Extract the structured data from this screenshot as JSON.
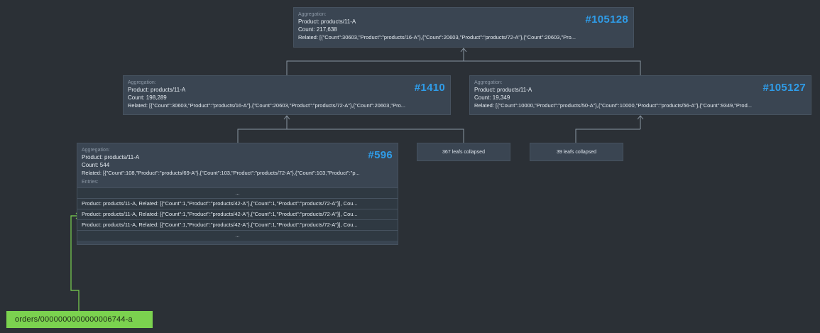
{
  "nodes": {
    "n105128": {
      "id": "#105128",
      "header": "Aggregation:",
      "product": "Product: products/11-A",
      "count": "Count: 217,638",
      "related": "Related: [{\"Count\":30603,\"Product\":\"products/16-A\"},{\"Count\":20603,\"Product\":\"products/72-A\"},{\"Count\":20603,\"Pro..."
    },
    "n1410": {
      "id": "#1410",
      "header": "Aggregation:",
      "product": "Product: products/11-A",
      "count": "Count: 198,289",
      "related": "Related: [{\"Count\":30603,\"Product\":\"products/16-A\"},{\"Count\":20603,\"Product\":\"products/72-A\"},{\"Count\":20603,\"Pro..."
    },
    "n105127": {
      "id": "#105127",
      "header": "Aggregation:",
      "product": "Product: products/11-A",
      "count": "Count: 19,349",
      "related": "Related: [{\"Count\":10000,\"Product\":\"products/50-A\"},{\"Count\":10000,\"Product\":\"products/56-A\"},{\"Count\":9349,\"Prod..."
    },
    "n596": {
      "id": "#596",
      "header": "Aggregation:",
      "product": "Product: products/11-A",
      "count": "Count: 544",
      "related": "Related: [{\"Count\":108,\"Product\":\"products/69-A\"},{\"Count\":103,\"Product\":\"products/72-A\"},{\"Count\":103,\"Product\":\"p...",
      "entries_header": "Entries:",
      "entries": [
        "...",
        "Product: products/11-A, Related: [{\"Count\":1,\"Product\":\"products/42-A\"},{\"Count\":1,\"Product\":\"products/72-A\"}], Cou...",
        "Product: products/11-A, Related: [{\"Count\":1,\"Product\":\"products/42-A\"},{\"Count\":1,\"Product\":\"products/72-A\"}], Cou...",
        "Product: products/11-A, Related: [{\"Count\":1,\"Product\":\"products/42-A\"},{\"Count\":1,\"Product\":\"products/72-A\"}], Cou...",
        "..."
      ]
    }
  },
  "collapsed": {
    "c367": "367 leafs collapsed",
    "c39": "39 leafs collapsed"
  },
  "document_tag": "orders/0000000000000006744-a",
  "colors": {
    "background": "#2b3036",
    "node": "#3a4552",
    "id_accent": "#2f9ce8",
    "tag": "#7bd24f",
    "wire": "#8a96a3"
  }
}
